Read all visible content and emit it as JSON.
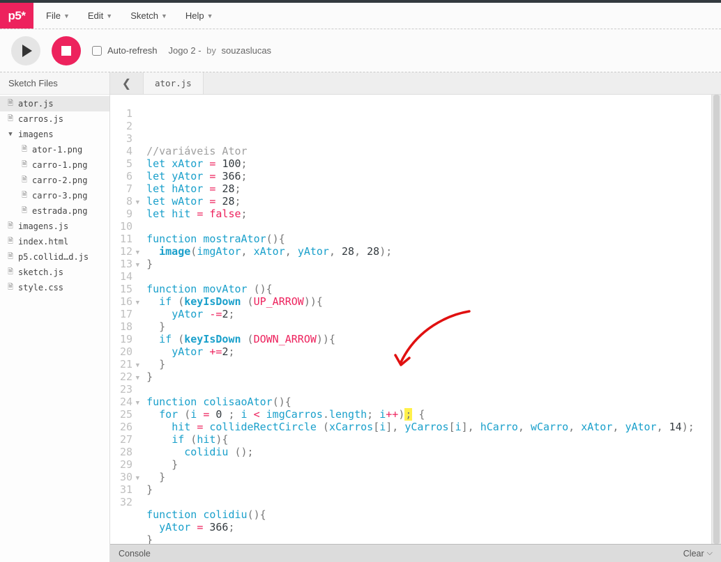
{
  "menubar": {
    "logo": "p5*",
    "items": [
      "File",
      "Edit",
      "Sketch",
      "Help"
    ]
  },
  "toolbar": {
    "autorefresh_label": "Auto-refresh",
    "project_name": "Jogo 2 -",
    "by_label": "by",
    "author": "souzaslucas"
  },
  "sidebar": {
    "header": "Sketch Files",
    "files": [
      {
        "name": "ator.js",
        "type": "file",
        "active": true,
        "indent": false
      },
      {
        "name": "carros.js",
        "type": "file",
        "active": false,
        "indent": false
      },
      {
        "name": "imagens",
        "type": "folder",
        "active": false,
        "indent": false,
        "open": true
      },
      {
        "name": "ator-1.png",
        "type": "file",
        "active": false,
        "indent": true
      },
      {
        "name": "carro-1.png",
        "type": "file",
        "active": false,
        "indent": true
      },
      {
        "name": "carro-2.png",
        "type": "file",
        "active": false,
        "indent": true
      },
      {
        "name": "carro-3.png",
        "type": "file",
        "active": false,
        "indent": true
      },
      {
        "name": "estrada.png",
        "type": "file",
        "active": false,
        "indent": true
      },
      {
        "name": "imagens.js",
        "type": "file",
        "active": false,
        "indent": false
      },
      {
        "name": "index.html",
        "type": "file",
        "active": false,
        "indent": false
      },
      {
        "name": "p5.collid…d.js",
        "type": "file",
        "active": false,
        "indent": false
      },
      {
        "name": "sketch.js",
        "type": "file",
        "active": false,
        "indent": false
      },
      {
        "name": "style.css",
        "type": "file",
        "active": false,
        "indent": false
      }
    ]
  },
  "tab": {
    "name": "ator.js"
  },
  "console": {
    "label": "Console",
    "clear": "Clear"
  },
  "code": {
    "lines": [
      {
        "n": 1,
        "fold": false,
        "html": "<span class='c-comment'>//variáveis Ator</span>"
      },
      {
        "n": 2,
        "fold": false,
        "html": "<span class='c-kw'>let</span> <span class='c-var'>xAtor</span> <span class='c-op'>=</span> <span class='c-num'>100</span>;"
      },
      {
        "n": 3,
        "fold": false,
        "html": "<span class='c-kw'>let</span> <span class='c-var'>yAtor</span> <span class='c-op'>=</span> <span class='c-num'>366</span>;"
      },
      {
        "n": 4,
        "fold": false,
        "html": "<span class='c-kw'>let</span> <span class='c-var'>hAtor</span> <span class='c-op'>=</span> <span class='c-num'>28</span>;"
      },
      {
        "n": 5,
        "fold": false,
        "html": "<span class='c-kw'>let</span> <span class='c-var'>wAtor</span> <span class='c-op'>=</span> <span class='c-num'>28</span>;"
      },
      {
        "n": 6,
        "fold": false,
        "html": "<span class='c-kw'>let</span> <span class='c-var'>hit</span> <span class='c-op'>=</span> <span class='c-bool'>false</span>;"
      },
      {
        "n": 7,
        "fold": false,
        "html": ""
      },
      {
        "n": 8,
        "fold": true,
        "html": "<span class='c-kw'>function</span> <span class='c-fnname'>mostraAtor</span>(){"
      },
      {
        "n": 9,
        "fold": false,
        "html": "  <span class='c-builtin'>image</span>(<span class='c-var'>imgAtor</span>, <span class='c-var'>xAtor</span>, <span class='c-var'>yAtor</span>, <span class='c-num'>28</span>, <span class='c-num'>28</span>);"
      },
      {
        "n": 10,
        "fold": false,
        "html": "}"
      },
      {
        "n": 11,
        "fold": false,
        "html": ""
      },
      {
        "n": 12,
        "fold": true,
        "html": "<span class='c-kw'>function</span> <span class='c-fnname'>movAtor</span> (){"
      },
      {
        "n": 13,
        "fold": true,
        "html": "  <span class='c-kw'>if</span> (<span class='c-builtin'>keyIsDown</span> (<span class='c-const'>UP_ARROW</span>)){"
      },
      {
        "n": 14,
        "fold": false,
        "html": "    <span class='c-var'>yAtor</span> <span class='c-op'>-=</span><span class='c-num'>2</span>;"
      },
      {
        "n": 15,
        "fold": false,
        "html": "  }"
      },
      {
        "n": 16,
        "fold": true,
        "html": "  <span class='c-kw'>if</span> (<span class='c-builtin'>keyIsDown</span> (<span class='c-const'>DOWN_ARROW</span>)){"
      },
      {
        "n": 17,
        "fold": false,
        "html": "    <span class='c-var'>yAtor</span> <span class='c-op'>+=</span><span class='c-num'>2</span>;"
      },
      {
        "n": 18,
        "fold": false,
        "html": "  }"
      },
      {
        "n": 19,
        "fold": false,
        "html": "}"
      },
      {
        "n": 20,
        "fold": false,
        "html": ""
      },
      {
        "n": 21,
        "fold": true,
        "html": "<span class='c-kw'>function</span> <span class='c-fnname'>colisaoAtor</span>(){"
      },
      {
        "n": 22,
        "fold": true,
        "html": "  <span class='c-kw'>for</span> (<span class='c-var'>i</span> <span class='c-op'>=</span> <span class='c-num'>0</span> ; <span class='c-var'>i</span> <span class='c-op'>&lt;</span> <span class='c-var'>imgCarros</span>.<span class='c-var'>length</span>; <span class='c-var'>i</span><span class='c-op'>++</span>)<span class='hl'>;</span> {"
      },
      {
        "n": 23,
        "fold": false,
        "html": "    <span class='c-var'>hit</span> <span class='c-op'>=</span> <span class='c-fnname'>collideRectCircle</span> (<span class='c-var'>xCarros</span>[<span class='c-var'>i</span>], <span class='c-var'>yCarros</span>[<span class='c-var'>i</span>], <span class='c-var'>hCarro</span>, <span class='c-var'>wCarro</span>, <span class='c-var'>xAtor</span>, <span class='c-var'>yAtor</span>, <span class='c-num'>14</span>);"
      },
      {
        "n": 24,
        "fold": true,
        "html": "    <span class='c-kw'>if</span> (<span class='c-var'>hit</span>){"
      },
      {
        "n": 25,
        "fold": false,
        "html": "      <span class='c-fnname'>colidiu</span> ();"
      },
      {
        "n": 26,
        "fold": false,
        "html": "    }"
      },
      {
        "n": 27,
        "fold": false,
        "html": "  }"
      },
      {
        "n": 28,
        "fold": false,
        "html": "}"
      },
      {
        "n": 29,
        "fold": false,
        "html": ""
      },
      {
        "n": 30,
        "fold": true,
        "html": "<span class='c-kw'>function</span> <span class='c-fnname'>colidiu</span>(){"
      },
      {
        "n": 31,
        "fold": false,
        "html": "  <span class='c-var'>yAtor</span> <span class='c-op'>=</span> <span class='c-num'>366</span>;"
      },
      {
        "n": 32,
        "fold": false,
        "html": "}"
      }
    ]
  }
}
